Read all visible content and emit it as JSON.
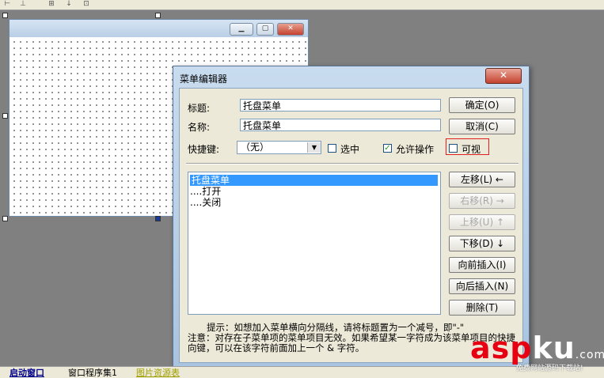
{
  "dialog": {
    "title": "菜单编辑器",
    "close_glyph": "✕",
    "caption_label": "标题:",
    "caption_value": "托盘菜单",
    "name_label": "名称:",
    "name_value": "托盘菜单",
    "shortcut_label": "快捷键:",
    "shortcut_value": "（无）",
    "checked_label": "选中",
    "enabled_label": "允许操作",
    "visible_label": "可视",
    "ok_button": "确定(O)",
    "cancel_button": "取消(C)",
    "move_left_button": "左移(L)  ←",
    "move_right_button": "右移(R)  →",
    "move_up_button": "上移(U)  ↑",
    "move_down_button": "下移(D)  ↓",
    "insert_before_button": "向前插入(I)",
    "insert_after_button": "向后插入(N)",
    "delete_button": "删除(T)",
    "menu_items": [
      "托盘菜单",
      "....打开",
      "....关闭"
    ],
    "hint_line1": "提示：如想加入菜单横向分隔线，请将标题置为一个减号，即\"-\"",
    "hint_line2": "注意：对存在子菜单项的菜单项目无效。如果希望某一字符成为该菜单项目的快捷",
    "hint_line3": "向键，可以在该字符前面加上一个 & 字符。"
  },
  "tabs": [
    "启动窗口",
    "窗口程序集1",
    "图片资源表"
  ],
  "watermark": {
    "brand_red": "asp",
    "brand_white": "ku",
    "brand_suffix": ".com",
    "subtitle": "免费网站源码下载站!"
  },
  "colors": {
    "dialog_face": "#ece9d8",
    "selection": "#3399ff",
    "visible_highlight": "#e02020",
    "watermark_red": "#e60012"
  }
}
